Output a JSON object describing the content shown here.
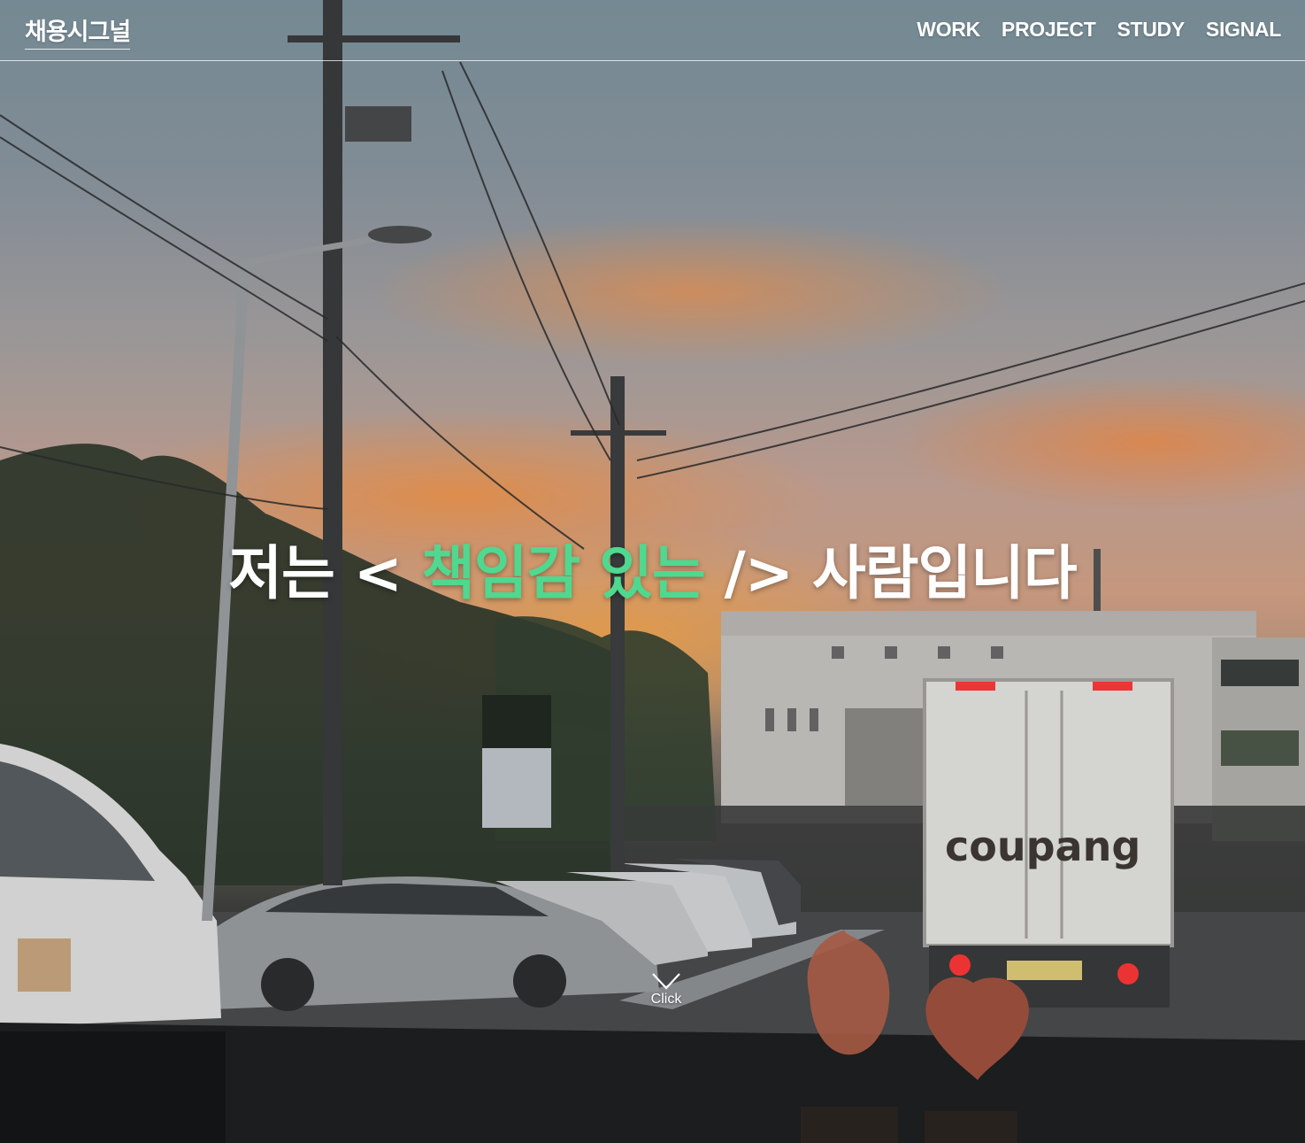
{
  "header": {
    "logo": "채용시그널",
    "nav": [
      "WORK",
      "PROJECT",
      "STUDY",
      "SIGNAL"
    ]
  },
  "hero": {
    "headline_prefix": "저는 <",
    "headline_accent": "책임감 있는",
    "headline_suffix": "/> 사람입니다",
    "scroll_label": "Click",
    "background_text": "coupang",
    "accent_color": "#4fd88f"
  }
}
